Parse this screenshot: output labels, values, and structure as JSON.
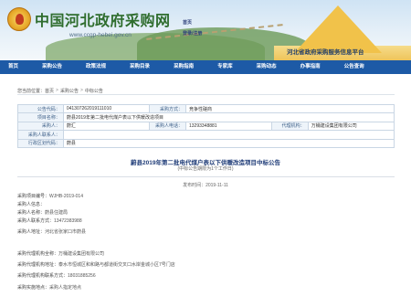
{
  "header": {
    "site_title": "中国河北政府采购网",
    "site_url": "www.ccgp-hebei.gov.cn",
    "login_top": "首页",
    "login_bottom": "登录/注册",
    "slogan": "河北省政府采购服务信息平台"
  },
  "nav": {
    "items": [
      "首页",
      "采购公告",
      "政策法规",
      "采购目录",
      "采购指南",
      "专家库",
      "采购动态",
      "办事指南",
      "公告查询"
    ]
  },
  "breadcrumb": {
    "label": "您当前位置：",
    "items": [
      "首页",
      "采购公告",
      "中标公告"
    ]
  },
  "info_table": {
    "rows": [
      {
        "l1": "公告代码：",
        "v1": "041307262019111010",
        "l2": "采购方式：",
        "v2": "竞争性磋商",
        "l3": "",
        "v3": ""
      },
      {
        "l1": "项目名称：",
        "v1": "蔚县2019年第二批电代煤户表以下供暖改造项目",
        "l2": "",
        "v2": "",
        "l3": "",
        "v3": ""
      },
      {
        "l1": "采购人：",
        "v1": "蔚汇",
        "l2": "采购人电话：",
        "v2": "13293348881",
        "l3": "代理机构：",
        "v3": "万桶建设集团有限公司"
      },
      {
        "l1": "采购人联系人：",
        "v1": "",
        "l2": "",
        "v2": "",
        "l3": "",
        "v3": ""
      },
      {
        "l1": "行政区划代码：",
        "v1": "蔚县",
        "l2": "",
        "v2": "",
        "l3": "",
        "v3": ""
      }
    ]
  },
  "announcement": {
    "title": "蔚县2019年第二批电代煤户表以下供暖改造项目中标公告",
    "subtitle": "(中标公告期限为1个工作日)",
    "publish_label": "发布时间：",
    "publish_date": "2019-11-11"
  },
  "details": {
    "project_no_label": "采购项目编号：",
    "project_no": "WJHB-2019-014",
    "buyer_info_label": "采购人信息：",
    "buyer_name_label": "采购人名称：",
    "buyer_name": "蔚县住建局",
    "buyer_contact_label": "采购人联系方式：",
    "buyer_contact": "13472383988",
    "buyer_addr_label": "采购人地址：",
    "buyer_addr": "河北省张家口市蔚县",
    "agency_name_label": "采购代理机构全称：",
    "agency_name": "万桶建设集团有限公司",
    "agency_addr_label": "采购代理机构地址：",
    "agency_addr": "泰水市恒城区和和路与都道街交叉口水岸金城小区7号门店",
    "agency_contact_label": "采购代理机构联系方式：",
    "agency_contact": "18031885256",
    "method_label": "采购实施地点：",
    "method_value": "采购人指定地点"
  }
}
